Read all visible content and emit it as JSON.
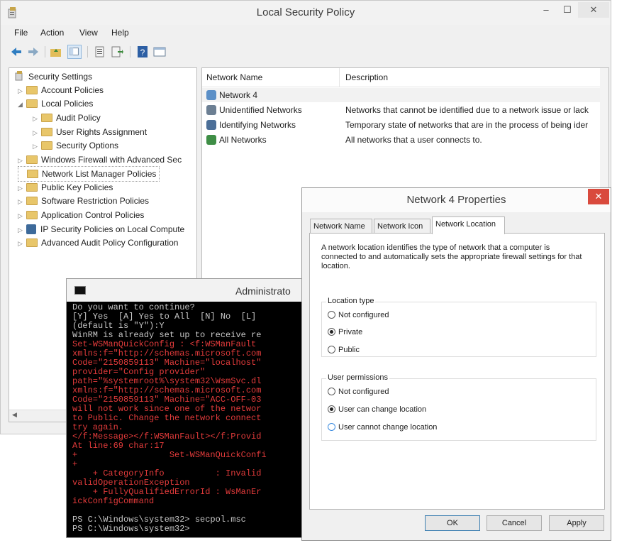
{
  "main_window": {
    "title": "Local Security Policy",
    "controls": {
      "minimize": "–",
      "maximize": "☐",
      "close": "✕"
    },
    "menu": [
      "File",
      "Action",
      "View",
      "Help"
    ]
  },
  "tree": {
    "items": [
      {
        "label": "Security Settings"
      },
      {
        "label": "Account Policies"
      },
      {
        "label": "Local Policies"
      },
      {
        "label": "Audit Policy"
      },
      {
        "label": "User Rights Assignment"
      },
      {
        "label": "Security Options"
      },
      {
        "label": "Windows Firewall with Advanced Sec"
      },
      {
        "label": "Network List Manager Policies"
      },
      {
        "label": "Public Key Policies"
      },
      {
        "label": "Software Restriction Policies"
      },
      {
        "label": "Application Control Policies"
      },
      {
        "label": "IP Security Policies on Local Compute"
      },
      {
        "label": "Advanced Audit Policy Configuration"
      }
    ]
  },
  "list": {
    "columns": [
      "Network Name",
      "Description"
    ],
    "rows": [
      {
        "name": "Network  4",
        "description": ""
      },
      {
        "name": "Unidentified Networks",
        "description": "Networks that cannot be identified due to a network issue or lack"
      },
      {
        "name": "Identifying Networks",
        "description": "Temporary state of networks that are in the process of being ider"
      },
      {
        "name": "All Networks",
        "description": "All networks that a user connects to."
      }
    ]
  },
  "console": {
    "title": "Administrato",
    "lines": [
      {
        "text": "Do you want to continue?",
        "color": "w"
      },
      {
        "text": "[Y] Yes  [A] Yes to All  [N] No  [L]",
        "color": "w"
      },
      {
        "text": "(default is \"Y\"):Y",
        "color": "w"
      },
      {
        "text": "WinRM is already set up to receive re",
        "color": "w"
      },
      {
        "text": "Set-WSManQuickConfig : <f:WSManFault",
        "color": "r"
      },
      {
        "text": "xmlns:f=\"http://schemas.microsoft.com",
        "color": "r"
      },
      {
        "text": "Code=\"2150859113\" Machine=\"localhost\"",
        "color": "r"
      },
      {
        "text": "provider=\"Config provider\"",
        "color": "r"
      },
      {
        "text": "path=\"%systemroot%\\system32\\WsmSvc.dl",
        "color": "r"
      },
      {
        "text": "xmlns:f=\"http://schemas.microsoft.com",
        "color": "r"
      },
      {
        "text": "Code=\"2150859113\" Machine=\"ACC-OFF-03",
        "color": "r"
      },
      {
        "text": "will not work since one of the networ",
        "color": "r"
      },
      {
        "text": "to Public. Change the network connect",
        "color": "r"
      },
      {
        "text": "try again.",
        "color": "r"
      },
      {
        "text": "</f:Message></f:WSManFault></f:Provid",
        "color": "r"
      },
      {
        "text": "At line:69 char:17",
        "color": "r"
      },
      {
        "text": "+                  Set-WSManQuickConfi",
        "color": "r"
      },
      {
        "text": "+",
        "color": "r"
      },
      {
        "text": "    + CategoryInfo          : Invalid",
        "color": "r"
      },
      {
        "text": "validOperationException",
        "color": "r"
      },
      {
        "text": "    + FullyQualifiedErrorId : WsManEr",
        "color": "r"
      },
      {
        "text": "ickConfigCommand",
        "color": "r"
      },
      {
        "text": "",
        "color": "w"
      },
      {
        "text": "PS C:\\Windows\\system32> secpol.msc",
        "color": "w"
      },
      {
        "text": "PS C:\\Windows\\system32>",
        "color": "w"
      }
    ]
  },
  "dialog": {
    "title": "Network  4 Properties",
    "close": "✕",
    "tabs": [
      "Network Name",
      "Network Icon",
      "Network Location"
    ],
    "active_tab": "Network Location",
    "description": "A network location identifies the type of network that a computer is connected to and automatically sets the appropriate firewall settings for that location.",
    "location_type": {
      "label": "Location type",
      "options": [
        "Not configured",
        "Private",
        "Public"
      ],
      "selected": "Private"
    },
    "user_permissions": {
      "label": "User permissions",
      "options": [
        "Not configured",
        "User can change location",
        "User cannot change location"
      ],
      "selected": "User can change location"
    },
    "buttons": {
      "ok": "OK",
      "cancel": "Cancel",
      "apply": "Apply"
    }
  }
}
